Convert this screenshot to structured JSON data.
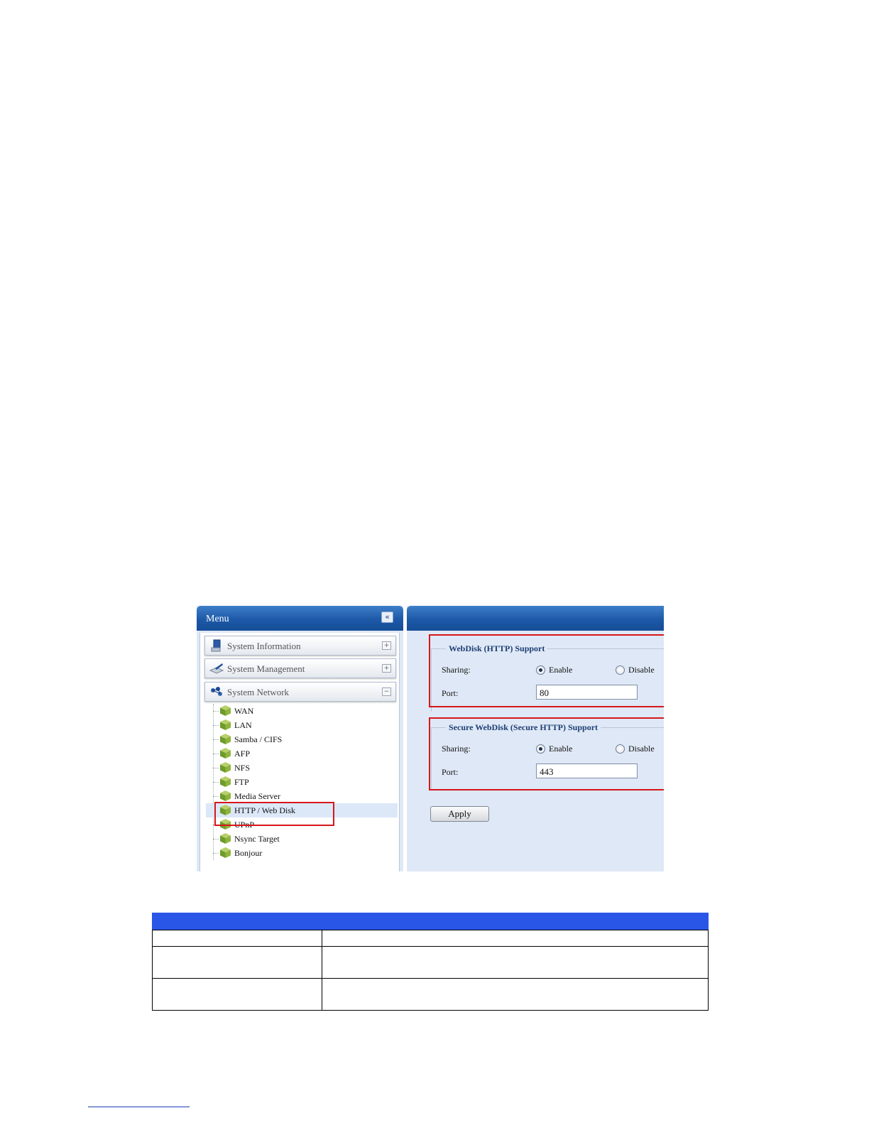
{
  "menu": {
    "title": "Menu",
    "collapse_icon": "«",
    "sections": [
      {
        "label": "System Information",
        "toggle": "+"
      },
      {
        "label": "System Management",
        "toggle": "+"
      },
      {
        "label": "System Network",
        "toggle": "−"
      }
    ],
    "items": [
      {
        "label": "WAN"
      },
      {
        "label": "LAN"
      },
      {
        "label": "Samba / CIFS"
      },
      {
        "label": "AFP"
      },
      {
        "label": "NFS"
      },
      {
        "label": "FTP"
      },
      {
        "label": "Media Server"
      },
      {
        "label": "HTTP / Web Disk",
        "selected": true
      },
      {
        "label": "UPnP"
      },
      {
        "label": "Nsync Target"
      },
      {
        "label": "Bonjour"
      }
    ]
  },
  "webdisk": {
    "legend": "WebDisk (HTTP) Support",
    "sharing_label": "Sharing:",
    "enable_label": "Enable",
    "disable_label": "Disable",
    "selected": "enable",
    "port_label": "Port:",
    "port_value": "80"
  },
  "secure_webdisk": {
    "legend": "Secure WebDisk (Secure HTTP) Support",
    "sharing_label": "Sharing:",
    "enable_label": "Enable",
    "disable_label": "Disable",
    "selected": "enable",
    "port_label": "Port:",
    "port_value": "443"
  },
  "apply_label": "Apply",
  "colors": {
    "header_blue": "#1d59a8",
    "panel_bg": "#dfe8f6",
    "highlight_red": "#d6161b",
    "table_header": "#2a56e8"
  }
}
